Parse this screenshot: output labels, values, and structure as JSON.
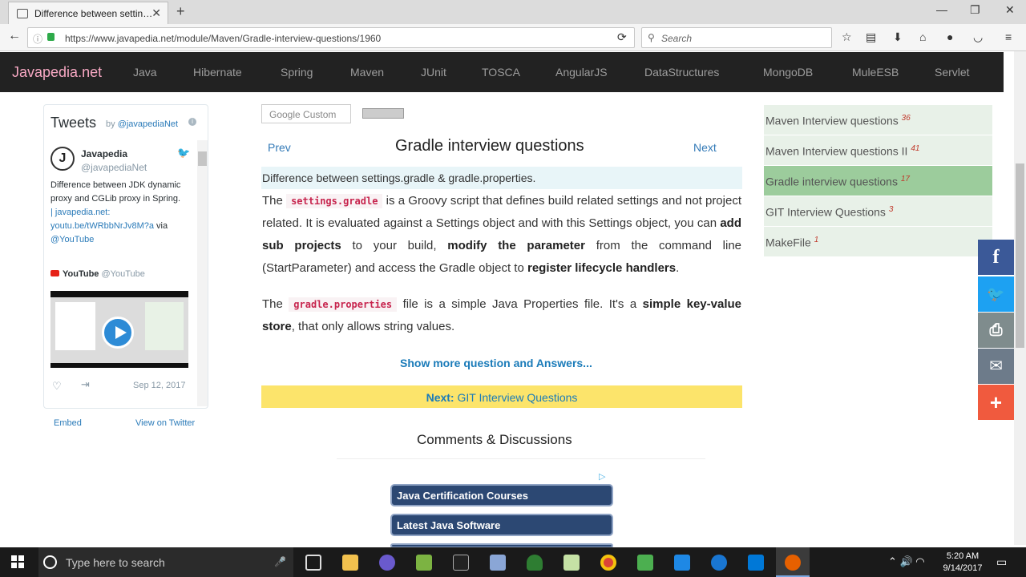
{
  "browser": {
    "tab_title": "Difference between settin…",
    "tab_close": "✕",
    "new_tab": "+",
    "url": "https://www.javapedia.net/module/Maven/Gradle-interview-questions/1960",
    "search_placeholder": "Search",
    "win_min": "—",
    "win_max": "❐",
    "win_close": "✕"
  },
  "site": {
    "brand": "Javapedia.net",
    "menu": [
      "Java",
      "Hibernate",
      "Spring",
      "Maven",
      "JUnit",
      "TOSCA",
      "AngularJS",
      "DataStructures",
      "MongoDB",
      "MuleESB",
      "Servlet"
    ]
  },
  "tweets": {
    "title": "Tweets",
    "by": "by",
    "handle_link": "@javapediaNet",
    "info": "i",
    "author_name": "Javapedia",
    "author_handle": "@javapediaNet",
    "avatar_letter": "J",
    "text": "Difference between JDK dynamic proxy and CGLib proxy in Spring.",
    "link1": "| javapedia.net:",
    "link2": "youtu.be/tWRbbNrJv8M?a",
    "via": " via",
    "via_handle": "@YouTube",
    "yt_name": "YouTube",
    "yt_handle": "@YouTube",
    "date": "Sep 12, 2017",
    "embed": "Embed",
    "view_on_twitter": "View on Twitter"
  },
  "main": {
    "google_search": "Google Custom",
    "prev": "Prev",
    "next": "Next",
    "title": "Gradle interview questions",
    "question": "Difference between settings.gradle & gradle.properties.",
    "p1": {
      "t1": "The ",
      "code": "settings.gradle",
      "t2": " is a Groovy script that defines build related settings and not project related. It is evaluated against a Settings object and with this Settings object, you can ",
      "b1": "add sub projects",
      "t3": " to your build, ",
      "b2": "modify the parameter",
      "t4": " from the command line (StartParameter) and access the Gradle object to ",
      "b3": "register lifecycle handlers",
      "t5": "."
    },
    "p2": {
      "t1": "The ",
      "code": "gradle.properties",
      "t2": " file is a simple Java Properties file. It's a ",
      "b1": "simple key-value store",
      "t3": ", that only allows string values."
    },
    "show_more": "Show more question and Answers...",
    "next_label": "Next:",
    "next_link": "GIT Interview Questions",
    "comments": "Comments & Discussions",
    "ad_choice": "▷",
    "ads": [
      "Java Certification Courses",
      "Latest Java Software"
    ]
  },
  "sidebar": {
    "items": [
      {
        "label": "Maven Interview questions",
        "count": "36"
      },
      {
        "label": "Maven Interview questions II",
        "count": "41"
      },
      {
        "label": "Gradle interview questions",
        "count": "17"
      },
      {
        "label": "GIT Interview Questions",
        "count": "3"
      },
      {
        "label": "MakeFile",
        "count": "1"
      }
    ]
  },
  "share": {
    "facebook": "f",
    "twitter": "🐦",
    "print": "⎙",
    "email": "✉",
    "more": "+"
  },
  "taskbar": {
    "search_text": "Type here to search",
    "time": "5:20 AM",
    "date": "9/14/2017",
    "tray_icons": "⌃ 🔊 ◠"
  },
  "colors": {
    "header_bg": "#222222",
    "brand": "#f7a8c3",
    "link": "#337ab7",
    "facebook": "#3b5998",
    "twitter": "#1da1f2",
    "print": "#7f8c8d",
    "email": "#6d7b8a",
    "more": "#f05a3e"
  }
}
